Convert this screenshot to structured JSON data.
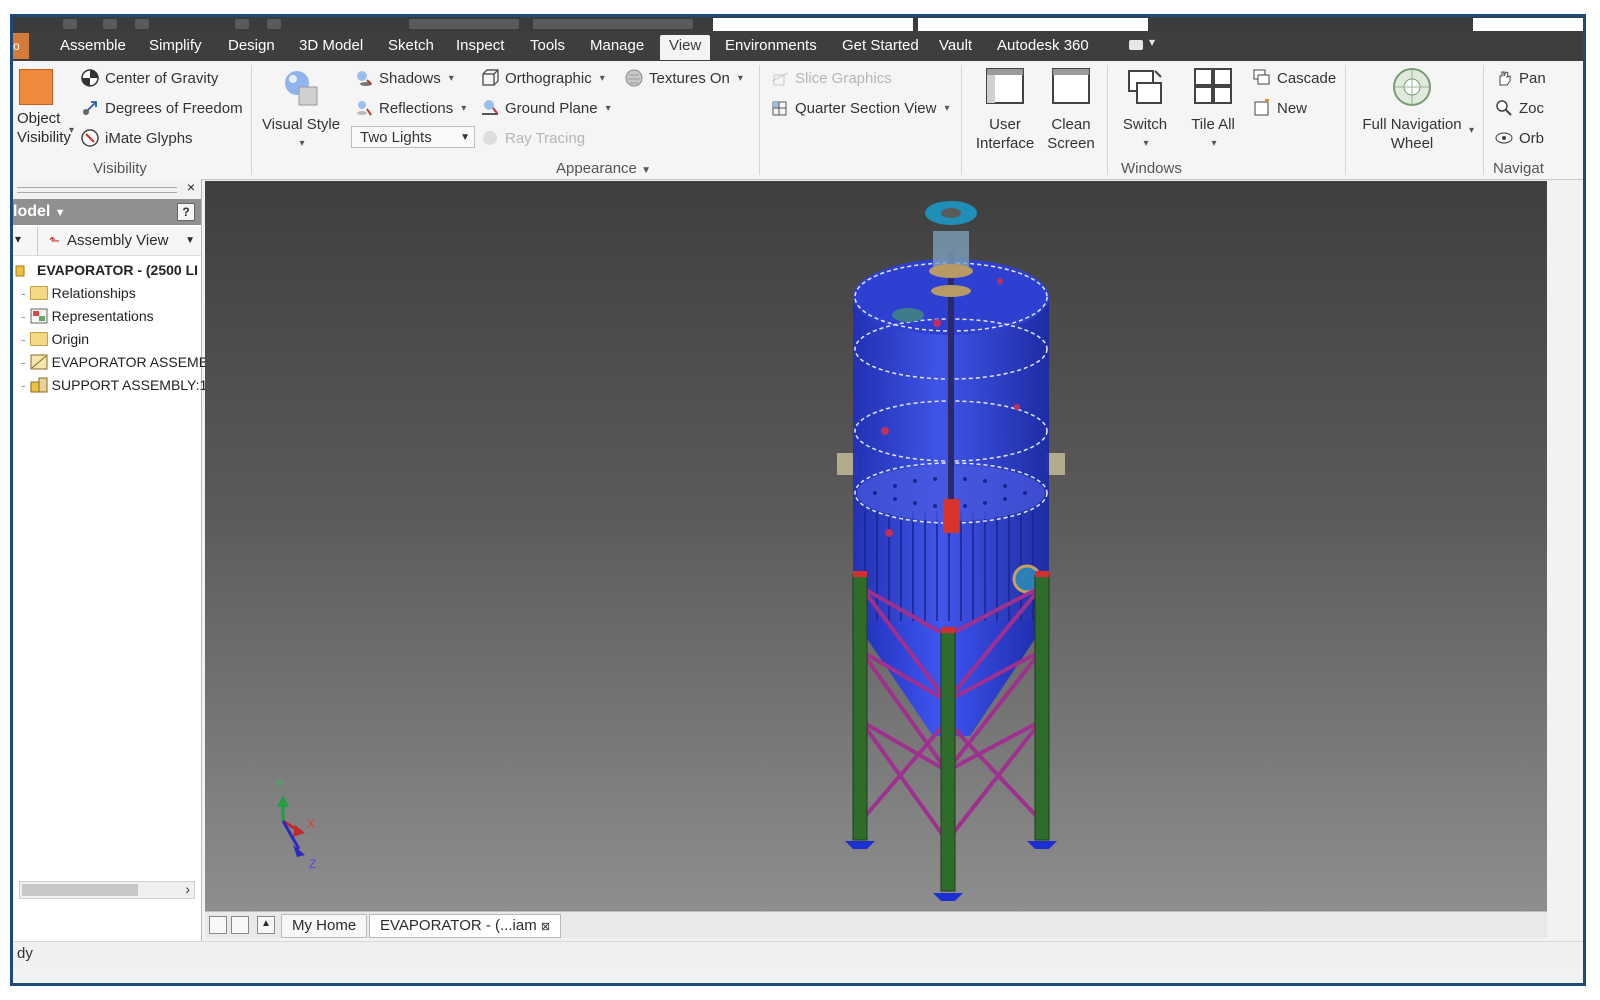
{
  "tabs": [
    "Assemble",
    "Simplify",
    "Design",
    "3D Model",
    "Sketch",
    "Inspect",
    "Tools",
    "Manage",
    "View",
    "Environments",
    "Get Started",
    "Vault",
    "Autodesk 360"
  ],
  "active_tab": "View",
  "ribbon": {
    "visibility": {
      "title": "Visibility",
      "object_visibility": "Object\nVisibility",
      "center_of_gravity": "Center of Gravity",
      "degrees_of_freedom": "Degrees of Freedom",
      "imate_glyphs": "iMate Glyphs"
    },
    "appearance": {
      "title": "Appearance",
      "visual_style": "Visual Style",
      "shadows": "Shadows",
      "reflections": "Reflections",
      "lighting": "Two Lights",
      "orthographic": "Orthographic",
      "ground_plane": "Ground Plane",
      "ray_tracing": "Ray Tracing",
      "textures_on": "Textures On",
      "slice_graphics": "Slice Graphics",
      "quarter_section_view": "Quarter Section View"
    },
    "windows": {
      "title": "Windows",
      "user_interface": "User\nInterface",
      "clean_screen": "Clean\nScreen",
      "switch": "Switch",
      "tile_all": "Tile All",
      "cascade": "Cascade",
      "new": "New"
    },
    "navigate": {
      "title": "Navigat",
      "full_navigation_wheel": "Full Navigation\nWheel",
      "pan": "Pan",
      "zoom": "Zoc",
      "orbit": "Orb"
    }
  },
  "browser": {
    "title": "lodel",
    "view": "Assembly View",
    "items": [
      {
        "label": "EVAPORATOR - (2500 LI",
        "type": "root"
      },
      {
        "label": "Relationships",
        "type": "folder"
      },
      {
        "label": "Representations",
        "type": "rep"
      },
      {
        "label": "Origin",
        "type": "folder"
      },
      {
        "label": "EVAPORATOR ASSEMBI",
        "type": "assembly"
      },
      {
        "label": "SUPPORT ASSEMBLY:1",
        "type": "assembly"
      }
    ]
  },
  "doc_tabs": [
    "My Home",
    "EVAPORATOR - (...iam"
  ],
  "status_text": "dy",
  "axes": {
    "x": "X",
    "y": "Y",
    "z": "Z"
  },
  "colors": {
    "accent": "#1e4a7a",
    "tank": "#2f3fd9",
    "legs": "#2f6b2a",
    "bracing": "#a0308f"
  }
}
